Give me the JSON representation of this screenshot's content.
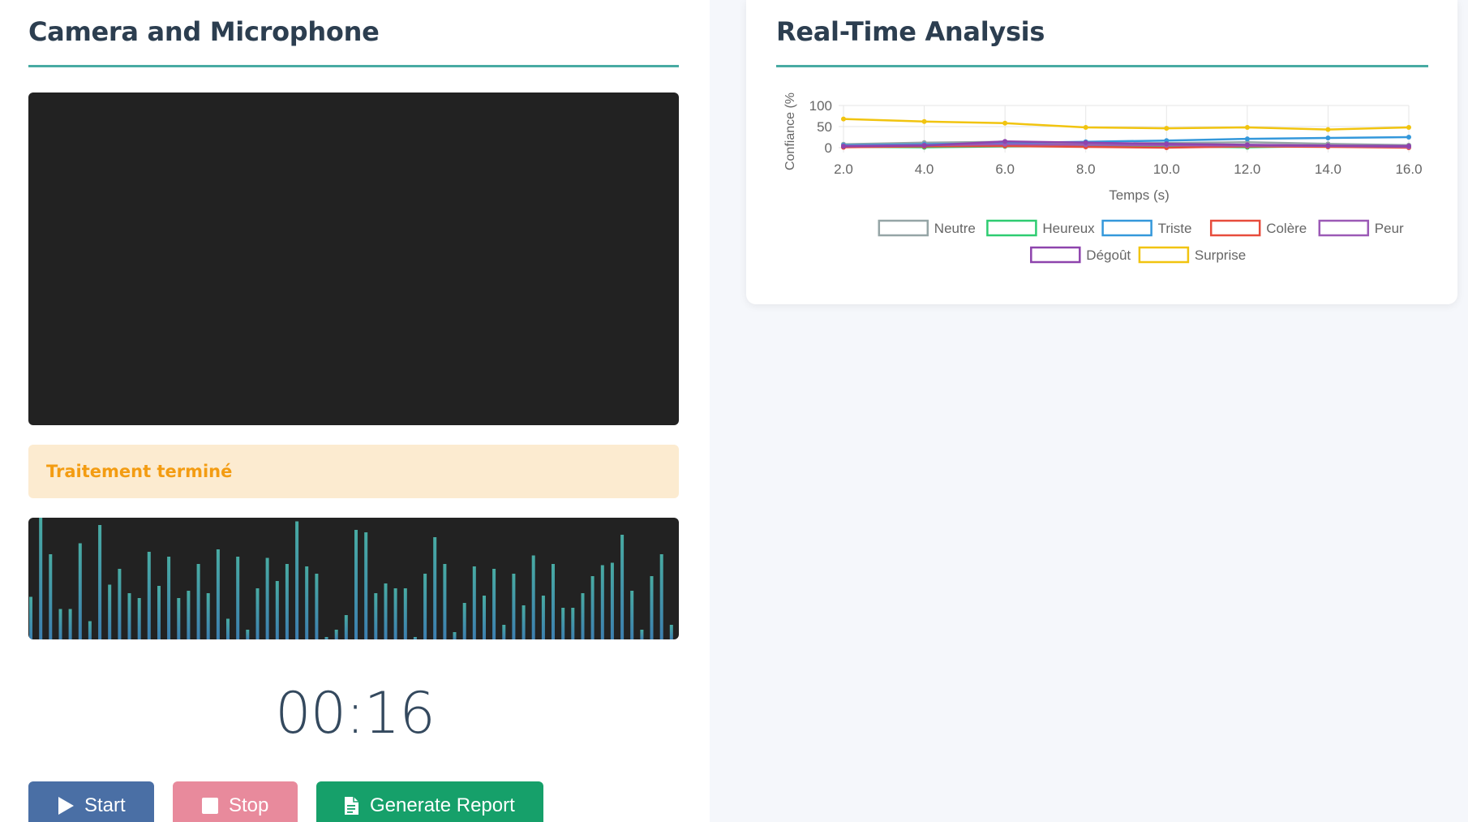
{
  "left": {
    "title": "Camera and Microphone",
    "status": "Traitement terminé",
    "timer": "00:16",
    "buttons": {
      "start": "Start",
      "stop": "Stop",
      "report": "Generate Report"
    }
  },
  "right": {
    "title": "Real-Time Analysis"
  },
  "colors": {
    "accent": "#48aba3",
    "start": "#4a6fa5",
    "stop": "#e88a9c",
    "report": "#16a06a",
    "status_text": "#f39c12",
    "status_bg": "#fcebd0"
  },
  "visualizer": {
    "levels": [
      0.35,
      1.0,
      0.7,
      0.25,
      0.25,
      0.79,
      0.15,
      0.94,
      0.45,
      0.58,
      0.38,
      0.34,
      0.72,
      0.44,
      0.68,
      0.34,
      0.4,
      0.62,
      0.38,
      0.74,
      0.17,
      0.68,
      0.08,
      0.42,
      0.67,
      0.48,
      0.62,
      0.97,
      0.6,
      0.54,
      0.02,
      0.08,
      0.2,
      0.9,
      0.88,
      0.38,
      0.46,
      0.42,
      0.42,
      0.02,
      0.54,
      0.84,
      0.62,
      0.06,
      0.3,
      0.6,
      0.36,
      0.58,
      0.12,
      0.54,
      0.28,
      0.69,
      0.36,
      0.62,
      0.26,
      0.26,
      0.38,
      0.52,
      0.61,
      0.63,
      0.86,
      0.4,
      0.08,
      0.52,
      0.7,
      0.12
    ]
  },
  "chart_data": {
    "type": "line",
    "xlabel": "Temps (s)",
    "ylabel": "Confiance (%",
    "x": [
      2.0,
      4.0,
      6.0,
      8.0,
      10.0,
      12.0,
      14.0,
      16.0
    ],
    "x_ticks": [
      "2.0",
      "4.0",
      "6.0",
      "8.0",
      "10.0",
      "12.0",
      "14.0",
      "16.0"
    ],
    "y_ticks": [
      "100",
      "50",
      "0"
    ],
    "ylim": [
      0,
      100
    ],
    "legend_position": "bottom",
    "series": [
      {
        "name": "Neutre",
        "color": "#95a5a6",
        "values": [
          8,
          12,
          14,
          10,
          11,
          13,
          9,
          6
        ]
      },
      {
        "name": "Heureux",
        "color": "#2ecc71",
        "values": [
          2,
          1,
          3,
          4,
          3,
          1,
          4,
          3
        ]
      },
      {
        "name": "Triste",
        "color": "#3498db",
        "values": [
          6,
          8,
          11,
          14,
          17,
          21,
          23,
          25
        ]
      },
      {
        "name": "Colère",
        "color": "#e74c3c",
        "values": [
          1,
          3,
          4,
          2,
          0,
          3,
          2,
          0
        ]
      },
      {
        "name": "Peur",
        "color": "#9b59b6",
        "values": [
          4,
          6,
          8,
          7,
          6,
          5,
          4,
          2
        ]
      },
      {
        "name": "Dégoût",
        "color": "#8e44ad",
        "values": [
          3,
          5,
          15,
          12,
          9,
          7,
          5,
          4
        ]
      },
      {
        "name": "Surprise",
        "color": "#f1c40f",
        "values": [
          68,
          62,
          58,
          48,
          46,
          48,
          43,
          48
        ]
      }
    ]
  }
}
